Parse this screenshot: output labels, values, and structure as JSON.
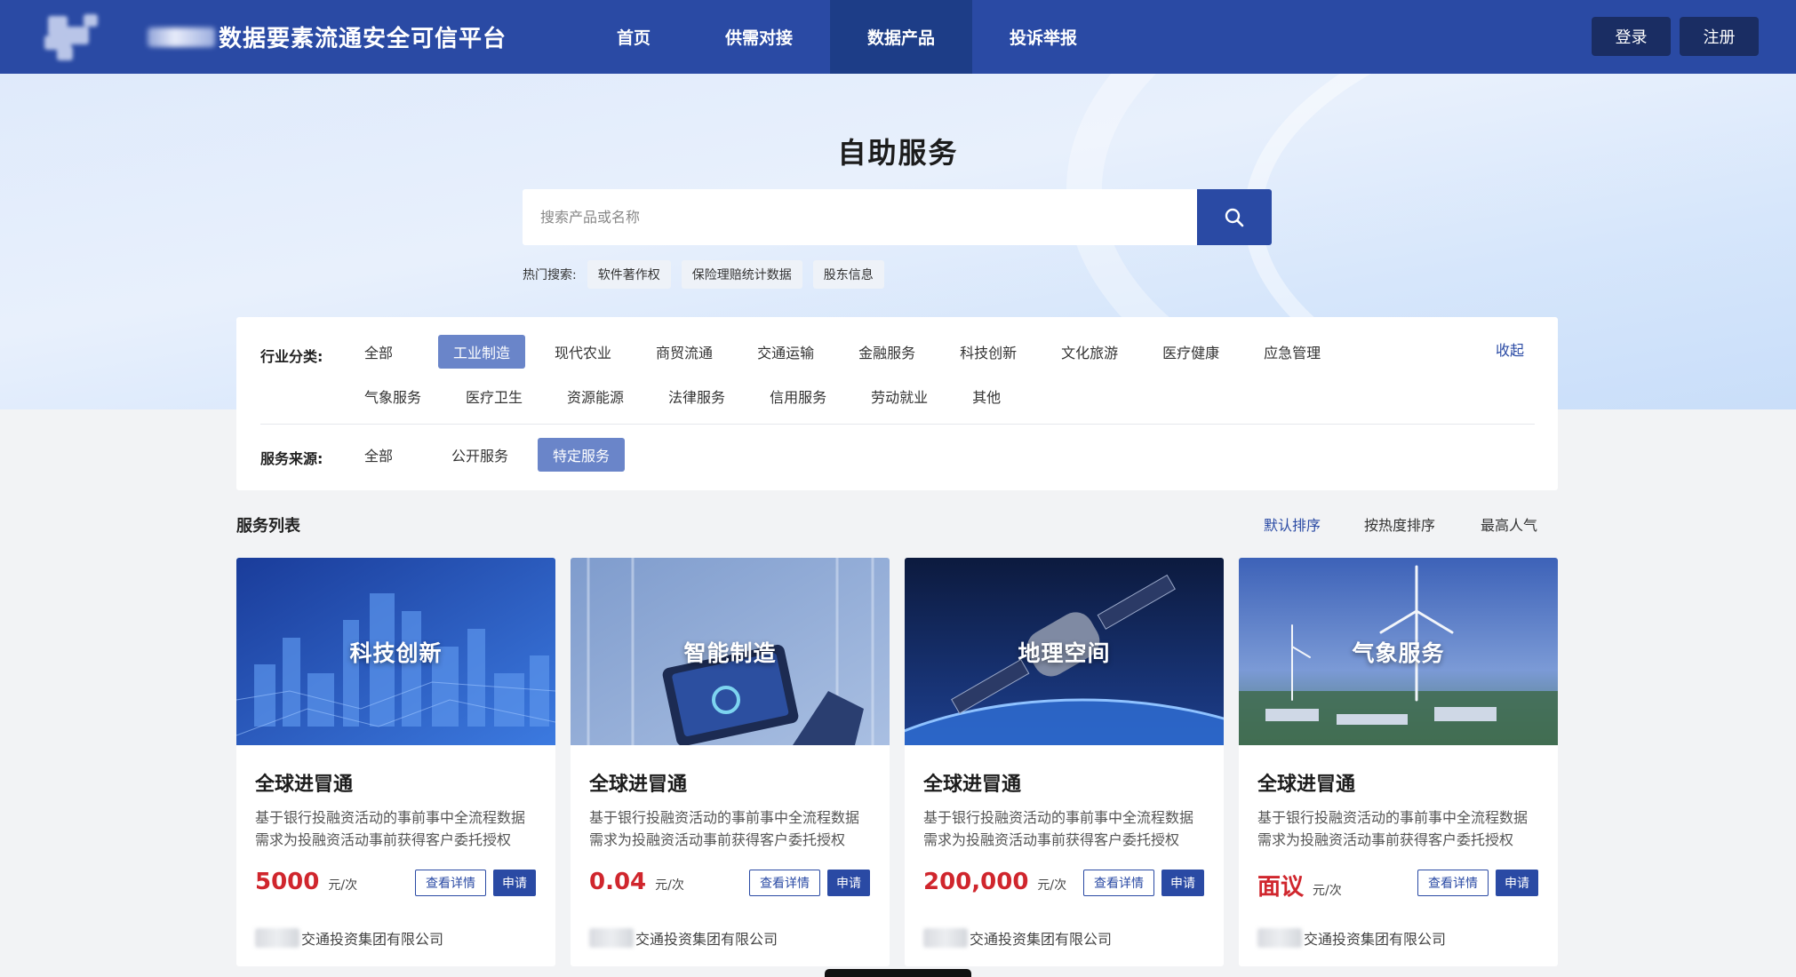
{
  "header": {
    "title": "数据要素流通安全可信平台",
    "nav": [
      {
        "label": "首页",
        "active": false
      },
      {
        "label": "供需对接",
        "active": false
      },
      {
        "label": "数据产品",
        "active": true
      },
      {
        "label": "投诉举报",
        "active": false
      }
    ],
    "login_label": "登录",
    "register_label": "注册"
  },
  "hero": {
    "title": "自助服务",
    "search_placeholder": "搜索产品或名称",
    "hot_label": "热门搜索:",
    "hot_tags": [
      "软件著作权",
      "保险理赔统计数据",
      "股东信息"
    ]
  },
  "filter": {
    "industry_label": "行业分类:",
    "industry_row1": [
      "全部",
      "工业制造",
      "现代农业",
      "商贸流通",
      "交通运输",
      "金融服务",
      "科技创新",
      "文化旅游",
      "医疗健康",
      "应急管理"
    ],
    "industry_row2": [
      "气象服务",
      "医疗卫生",
      "资源能源",
      "法律服务",
      "信用服务",
      "劳动就业",
      "其他"
    ],
    "industry_active": "工业制造",
    "collapse_label": "收起",
    "source_label": "服务来源:",
    "source_options": [
      "全部",
      "公开服务",
      "特定服务"
    ],
    "source_active": "特定服务"
  },
  "list": {
    "title": "服务列表",
    "sorts": [
      {
        "label": "默认排序",
        "active": true
      },
      {
        "label": "按热度排序",
        "active": false
      },
      {
        "label": "最高人气",
        "active": false
      }
    ]
  },
  "cards": [
    {
      "category": "科技创新",
      "title": "全球进冒通",
      "desc": "基于银行投融资活动的事前事中全流程数据需求为投融资活动事前获得客户委托授权",
      "price": "5000",
      "unit": "元/次",
      "detail_label": "查看详情",
      "apply_label": "申请",
      "company": "交通投资集团有限公司"
    },
    {
      "category": "智能制造",
      "title": "全球进冒通",
      "desc": "基于银行投融资活动的事前事中全流程数据需求为投融资活动事前获得客户委托授权",
      "price": "0.04",
      "unit": "元/次",
      "detail_label": "查看详情",
      "apply_label": "申请",
      "company": "交通投资集团有限公司"
    },
    {
      "category": "地理空间",
      "title": "全球进冒通",
      "desc": "基于银行投融资活动的事前事中全流程数据需求为投融资活动事前获得客户委托授权",
      "price": "200,000",
      "unit": "元/次",
      "detail_label": "查看详情",
      "apply_label": "申请",
      "company": "交通投资集团有限公司"
    },
    {
      "category": "气象服务",
      "title": "全球进冒通",
      "desc": "基于银行投融资活动的事前事中全流程数据需求为投融资活动事前获得客户委托授权",
      "price": "面议",
      "unit": "元/次",
      "detail_label": "查看详情",
      "apply_label": "申请",
      "company": "交通投资集团有限公司"
    }
  ],
  "colors": {
    "primary": "#2a4aa4",
    "nav_active": "#1d3d87",
    "auth_button": "#1a2d63",
    "filter_active": "#6a85c9",
    "price": "#d0262d"
  }
}
